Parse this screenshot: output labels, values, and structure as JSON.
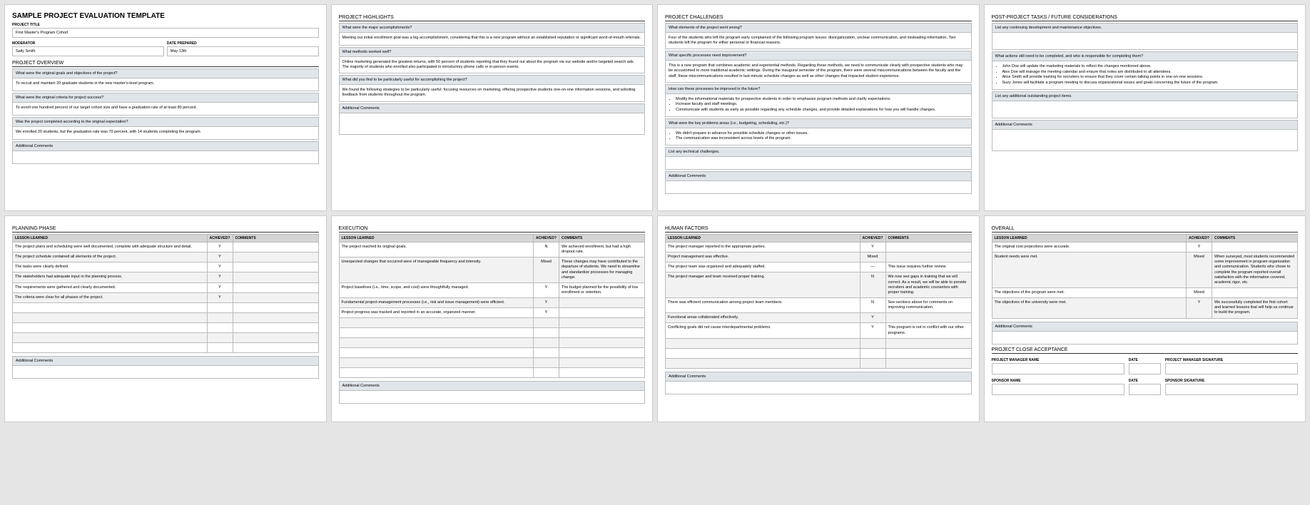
{
  "p1": {
    "title_main": "SAMPLE PROJECT EVALUATION TEMPLATE",
    "label_project_title": "PROJECT TITLE",
    "val_project_title": "First Master's Program Cohort",
    "label_moderator": "MODERATOR",
    "val_moderator": "Sally Smith",
    "label_date_prepared": "DATE PREPARED",
    "val_date_prepared": "May 13th",
    "sec_overview": "PROJECT OVERVIEW",
    "q1": "What were the original goals and objectives of the project?",
    "a1": "To recruit and maintain 20 graduate students in the new master's-level program.",
    "q2": "What were the original criteria for project success?",
    "a2": "To enroll one hundred percent of our target cohort size and have a graduation rate of at least 80 percent.",
    "q3": "Was the project completed according to the original expectation?",
    "a3": "We enrolled 20 students, but the graduation rate was 70 percent, with 14 students completing the program.",
    "additional": "Additional Comments"
  },
  "p2": {
    "sec": "PROJECT HIGHLIGHTS",
    "q1": "What were the major accomplishments?",
    "a1": "Meeting our initial enrollment goal was a big accomplishment, considering that this is a new program without an established reputation or significant word-of-mouth referrals.",
    "q2": "What methods worked well?",
    "a2": "Online marketing generated the greatest returns, with 50 percent of students reporting that they found out about the program via our website and/or targeted search ads. The majority of students who enrolled also participated in introductory phone calls or in-person events.",
    "q3": "What did you find to be particularly useful for accomplishing the project?",
    "a3": "We found the following strategies to be particularly useful: focusing resources on marketing, offering prospective students one-on-one information sessions, and soliciting feedback from students throughout the program.",
    "additional": "Additional Comments"
  },
  "p3": {
    "sec": "PROJECT CHALLENGES",
    "q1": "What elements of the project went wrong?",
    "a1": "Four of the students who left the program early complained of the following program issues: disorganization, unclear communication, and misleading information. Two students left the program for either personal or financial reasons.",
    "q2": "What specific processes need improvement?",
    "a2": "This is a new program that combines academic and experiential methods. Regarding these methods, we need to communicate clearly with prospective students who may be accustomed to more traditional academic settings. During the inaugural semester of the program, there were several miscommunications between the faculty and the staff; these miscommunications resulted in last-minute schedule changes as well as other changes that impacted student experience.",
    "q3": "How can these processes be improved in the future?",
    "a3_items": [
      "Modify the informational materials for prospective students in order to emphasize program methods and clarify expectations.",
      "Increase faculty and staff meetings.",
      "Communicate with students as early as possible regarding any schedule changes, and provide detailed explanations for how you will handle changes."
    ],
    "q4": "What were the key problems areas (i.e., budgeting, scheduling, etc.)?",
    "a4_items": [
      "We didn't prepare in advance for possible schedule changes or other issues.",
      "The communication was inconsistent across levels of the program."
    ],
    "q5": "List any technical challenges.",
    "additional": "Additional Comments"
  },
  "p4": {
    "sec": "POST-PROJECT TASKS / FUTURE CONSIDERATIONS",
    "q1": "List any continuing development and maintenance objectives.",
    "q2": "What actions still need to be completed, and who is responsible for completing them?",
    "a2_items": [
      "John Doe will update the marketing materials to reflect the changes mentioned above.",
      "Alex Doe will manage the meeting calendar and ensure that notes are distributed to all attendees.",
      "Alice Smith will provide training for recruiters to ensure that they cover certain talking points in one-on-one sessions.",
      "Suzy Jones will facilitate a program meeting to discuss organizational issues and goals concerning the future of the program."
    ],
    "q3": "List any additional outstanding project items.",
    "additional": "Additional Comments"
  },
  "p5": {
    "sec": "PLANNING PHASE",
    "th_lesson": "LESSON LEARNED",
    "th_ach": "ACHIEVED?",
    "th_comm": "COMMENTS",
    "rows": [
      {
        "l": "The project plans and scheduling were well documented, complete with adequate structure and detail.",
        "a": "Y",
        "c": ""
      },
      {
        "l": "The project schedule contained all elements of the project.",
        "a": "Y",
        "c": ""
      },
      {
        "l": "The tasks were clearly defined.",
        "a": "Y",
        "c": ""
      },
      {
        "l": "The stakeholders had adequate input in the planning process.",
        "a": "Y",
        "c": ""
      },
      {
        "l": "The requirements were gathered and clearly documented.",
        "a": "Y",
        "c": ""
      },
      {
        "l": "The criteria were clear for all phases of the project.",
        "a": "Y",
        "c": ""
      }
    ],
    "empty_rows": 5,
    "additional": "Additional Comments"
  },
  "p6": {
    "sec": "EXECUTION",
    "th_lesson": "LESSON LEARNED",
    "th_ach": "ACHIEVED?",
    "th_comm": "COMMENTS",
    "rows": [
      {
        "l": "The project reached its original goals.",
        "a": "N",
        "c": "We achieved enrollment, but had a high dropout rate."
      },
      {
        "l": "Unexpected changes that occurred were of manageable frequency and intensity.",
        "a": "Mixed",
        "c": "These changes may have contributed to the departure of students. We need to streamline and standardize processes for managing change."
      },
      {
        "l": "Project baselines (i.e., time, scope, and cost) were thoughtfully managed.",
        "a": "Y",
        "c": "The budget planned for the possibility of low enrollment or retention."
      },
      {
        "l": "Fundamental project-management processes (i.e., risk and issue management) were efficient.",
        "a": "Y",
        "c": ""
      },
      {
        "l": "Project progress was tracked and reported in an accurate, organized manner.",
        "a": "Y",
        "c": ""
      }
    ],
    "empty_rows": 6,
    "additional": "Additional Comments"
  },
  "p7": {
    "sec": "HUMAN FACTORS",
    "th_lesson": "LESSON LEARNED",
    "th_ach": "ACHIEVED?",
    "th_comm": "COMMENTS",
    "rows": [
      {
        "l": "The project manager reported to the appropriate parties.",
        "a": "Y",
        "c": ""
      },
      {
        "l": "Project management was effective.",
        "a": "Mixed",
        "c": ""
      },
      {
        "l": "The project team was organized and adequately staffed.",
        "a": "—",
        "c": "This issue requires further review."
      },
      {
        "l": "The project manager and team received proper training.",
        "a": "N",
        "c": "We now see gaps in training that we will correct. As a result, we will be able to provide recruiters and academic counselors with proper training."
      },
      {
        "l": "There was efficient communication among project team members.",
        "a": "N",
        "c": "See sections above for comments on improving communication."
      },
      {
        "l": "Functional areas collaborated effectively.",
        "a": "Y",
        "c": ""
      },
      {
        "l": "Conflicting goals did not cause interdepartmental problems.",
        "a": "Y",
        "c": "This program is not in conflict with our other programs."
      }
    ],
    "empty_rows": 3,
    "additional": "Additional Comments"
  },
  "p8": {
    "sec": "OVERALL",
    "th_lesson": "LESSON LEARNED",
    "th_ach": "ACHIEVED?",
    "th_comm": "COMMENTS",
    "rows": [
      {
        "l": "The original cost projections were accurate.",
        "a": "Y",
        "c": ""
      },
      {
        "l": "Student needs were met.",
        "a": "Mixed",
        "c": "When surveyed, most students recommended some improvement in program organization and communication. Students who chose to complete the program reported overall satisfaction with the information covered, academic rigor, etc."
      },
      {
        "l": "The objectives of the program were met.",
        "a": "Mixed",
        "c": ""
      },
      {
        "l": "The objectives of the university were met.",
        "a": "Y",
        "c": "We successfully completed the first cohort and learned lessons that will help us continue to build the program."
      }
    ],
    "additional": "Additional Comments",
    "sec_close": "PROJECT CLOSE ACCEPTANCE",
    "lbl_pm_name": "PROJECT MANAGER NAME",
    "lbl_date": "DATE",
    "lbl_pm_sig": "PROJECT MANAGER SIGNATURE",
    "lbl_sponsor_name": "SPONSOR NAME",
    "lbl_sponsor_sig": "SPONSOR SIGNATURE"
  }
}
